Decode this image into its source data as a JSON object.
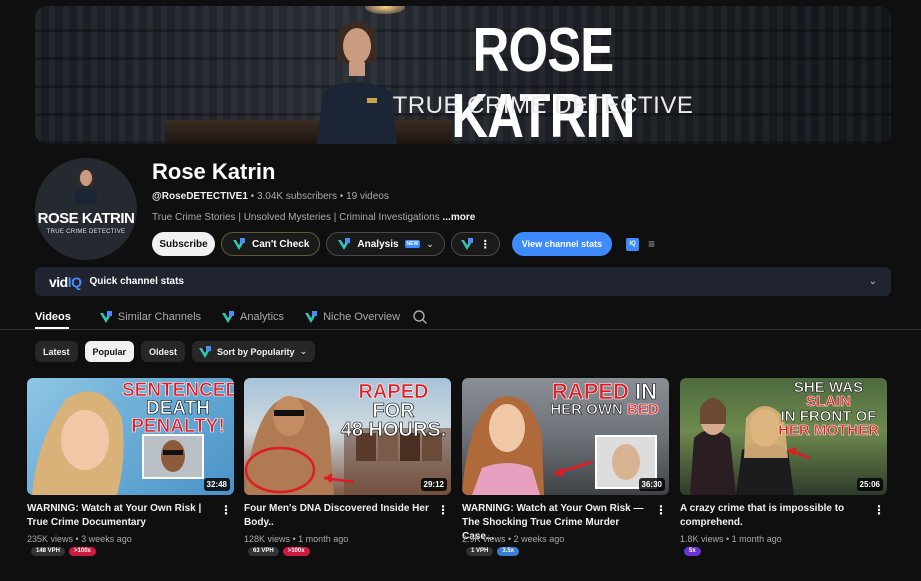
{
  "banner": {
    "title": "ROSE KATRIN",
    "subtitle": "TRUE CRIME DETECTIVE"
  },
  "avatar": {
    "name": "ROSE KATRIN",
    "sub": "TRUE CRIME DETECTIVE"
  },
  "channel": {
    "name": "Rose Katrin",
    "handle": "@RoseDETECTIVE1",
    "subscribers": "3.04K subscribers",
    "videos_count": "19 videos",
    "description": "True Crime Stories | Unsolved Mysteries | Criminal Investigations",
    "more_label": "...more"
  },
  "actions": {
    "subscribe": "Subscribe",
    "cant_check": "Can't Check",
    "analysis": "Analysis",
    "new_badge": "NEW",
    "view_stats": "View channel stats",
    "iq": "IQ"
  },
  "quickbar": {
    "brand_a": "vid",
    "brand_b": "IQ",
    "label": "Quick channel stats"
  },
  "tabs": [
    "Videos",
    "Similar Channels",
    "Analytics",
    "Niche Overview"
  ],
  "filters": {
    "latest": "Latest",
    "popular": "Popular",
    "oldest": "Oldest",
    "sort": "Sort by Popularity"
  },
  "videos": [
    {
      "thumb_l1": "SENTENCED:",
      "thumb_l2": "DEATH",
      "thumb_l3": "PENALTY!",
      "duration": "32:48",
      "title": "WARNING: Watch at Your Own Risk | True Crime Documentary",
      "meta": "235K views • 3 weeks ago",
      "vph": "148 VPH",
      "mult": ">100x"
    },
    {
      "thumb_l1": "RAPED",
      "thumb_l1b": "FOR",
      "thumb_l2": "48 HOURS.",
      "duration": "29:12",
      "title": "Four Men's DNA Discovered Inside Her Body..",
      "meta": "128K views • 1 month ago",
      "vph": "63 VPH",
      "mult": ">100x"
    },
    {
      "thumb_l1": "RAPED",
      "thumb_l1b": "IN",
      "thumb_l2": "HER OWN",
      "thumb_l2b": "BED",
      "duration": "36:30",
      "title": "WARNING: Watch at Your Own Risk — The Shocking True Crime Murder Case...",
      "meta": "2.9K views • 2 weeks ago",
      "vph": "1 VPH",
      "mult": "3.5x"
    },
    {
      "thumb_l1": "SHE WAS",
      "thumb_l1b": "SLAIN",
      "thumb_l2": "IN FRONT OF",
      "thumb_l3": "HER MOTHER",
      "duration": "25:06",
      "title": "A crazy crime that is impossible to comprehend.",
      "meta": "1.8K views • 1 month ago",
      "mult": "5x"
    }
  ],
  "colors": {
    "accent_blue": "#3e8bff",
    "badge_red": "#cc1b3f",
    "badge_purple": "#6b33d6",
    "thumb_red": "#e21b23"
  }
}
